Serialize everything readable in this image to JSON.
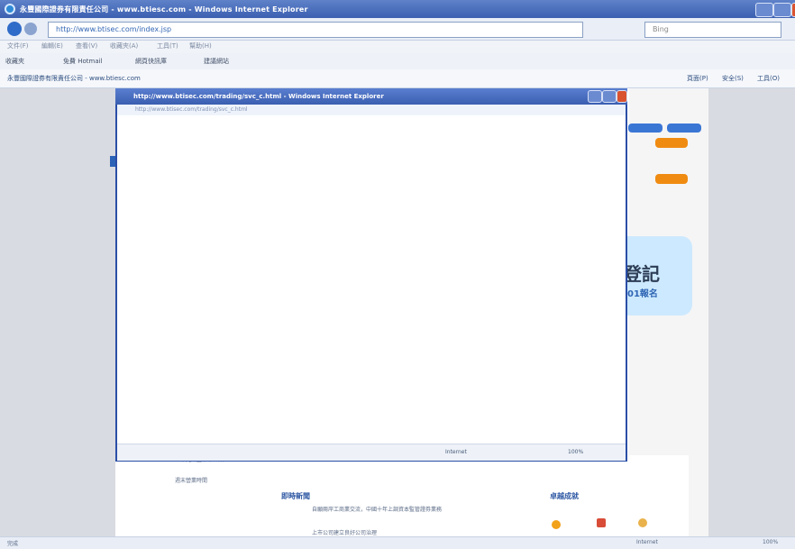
{
  "browser": {
    "window_title": "永豐國際證券有限責任公司 - www.btiesc.com - Windows Internet Explorer",
    "address_url": "http://www.btisec.com/index.jsp",
    "search_placeholder": "Bing",
    "menus": [
      "文件(F)",
      "編輯(E)",
      "查看(V)",
      "收藏夾(A)",
      "工具(T)",
      "幫助(H)"
    ],
    "favorites": [
      "收藏夾",
      "免費 Hotmail",
      "網頁快訊庫",
      "建議網站"
    ],
    "tab_label": "永豐國際證券有限責任公司 - www.btiesc.com",
    "toolbar_right": [
      "頁面(P)",
      "安全(S)",
      "工具(O)"
    ]
  },
  "page": {
    "right_title": "登記",
    "right_subtitle": "01報名",
    "lower_mid_heading": "即時新聞",
    "lower_right_heading": "卓越成就",
    "lower_left_texts": [
      "上午九點至下午一點",
      "週末營業時間"
    ],
    "news_items": [
      "自願兩岸工商業交流，中國十年上調資本監管證券業務",
      "上市公司建立良好公司治理"
    ]
  },
  "popup": {
    "window_title": "http://www.btisec.com/trading/svc_c.html - Windows Internet Explorer",
    "address_url": "http://www.btisec.com/trading/svc_c.html",
    "status_zone": "Internet",
    "zoom": "100%"
  },
  "status": {
    "left": "完成",
    "zone": "Internet",
    "zoom": "100%"
  }
}
